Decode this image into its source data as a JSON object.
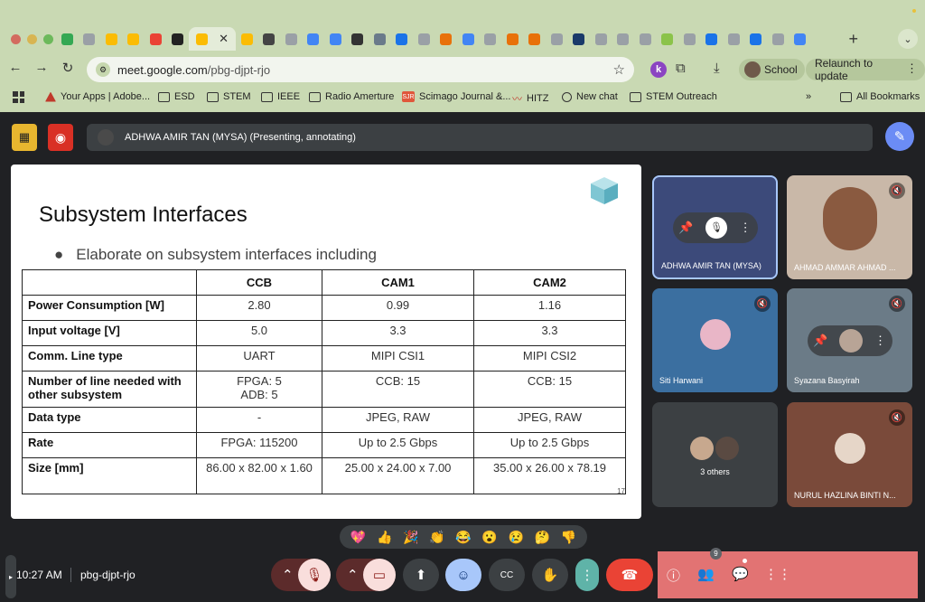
{
  "browser": {
    "tabs": [
      {
        "color": "#34a853"
      },
      {
        "color": "#9aa0a6"
      },
      {
        "color": "#fbbc04"
      },
      {
        "color": "#fbbc04"
      },
      {
        "color": "#ea4335"
      },
      {
        "color": "#222222"
      },
      {
        "color": "#fbbc04"
      },
      {
        "color": "#fbbc04"
      },
      {
        "color": "#444444"
      },
      {
        "color": "#9aa0a6"
      },
      {
        "color": "#4285f4"
      },
      {
        "color": "#4285f4"
      },
      {
        "color": "#333333"
      },
      {
        "color": "#6a7a8a"
      },
      {
        "color": "#1a73e8"
      },
      {
        "color": "#9aa0a6"
      },
      {
        "color": "#e8710a"
      },
      {
        "color": "#4285f4"
      },
      {
        "color": "#9aa0a6"
      },
      {
        "color": "#e8710a"
      },
      {
        "color": "#e8710a"
      },
      {
        "color": "#9aa0a6"
      },
      {
        "color": "#1a3a6a"
      },
      {
        "color": "#9aa0a6"
      },
      {
        "color": "#9aa0a6"
      },
      {
        "color": "#9aa0a6"
      },
      {
        "color": "#8bc34a"
      },
      {
        "color": "#9aa0a6"
      },
      {
        "color": "#1a73e8"
      },
      {
        "color": "#9aa0a6"
      },
      {
        "color": "#1a73e8"
      },
      {
        "color": "#9aa0a6"
      },
      {
        "color": "#4285f4"
      }
    ],
    "active_tab_close": "✕",
    "new_tab": "+",
    "url_host": "meet.google.com",
    "url_path": "/pbg-djpt-rjo",
    "profile_letter": "k",
    "school_label": "School",
    "relaunch_label": "Relaunch to update",
    "bookmarks": [
      {
        "label": "Your Apps | Adobe...",
        "icon": "adobe-icon"
      },
      {
        "label": "ESD",
        "icon": "folder-icon"
      },
      {
        "label": "STEM",
        "icon": "folder-icon"
      },
      {
        "label": "IEEE",
        "icon": "folder-icon"
      },
      {
        "label": "Radio Amerture",
        "icon": "folder-icon"
      },
      {
        "label": "Scimago Journal &...",
        "icon": "sjr-icon"
      },
      {
        "label": "HITZ",
        "icon": "hitz-icon"
      },
      {
        "label": "New chat",
        "icon": "openai-icon"
      },
      {
        "label": "STEM Outreach",
        "icon": "folder-icon"
      }
    ],
    "bookmarks_more": "»",
    "all_bookmarks": "All Bookmarks",
    "sjr_badge": "SJR",
    "hitz_badge": "〰"
  },
  "meet": {
    "presenter_text": "ADHWA AMIR TAN (MYSA) (Presenting, annotating)",
    "slide": {
      "title": "Subsystem Interfaces",
      "bullet": "Elaborate on subsystem interfaces including",
      "page_number": "17",
      "table": {
        "headers": [
          "",
          "CCB",
          "CAM1",
          "CAM2"
        ],
        "rows": [
          {
            "label": "Power Consumption [W]",
            "ccb": "2.80",
            "cam1": "0.99",
            "cam2": "1.16"
          },
          {
            "label": "Input voltage [V]",
            "ccb": "5.0",
            "cam1": "3.3",
            "cam2": "3.3"
          },
          {
            "label": "Comm. Line type",
            "ccb": "UART",
            "cam1": "MIPI CSI1",
            "cam2": "MIPI CSI2"
          },
          {
            "label": "Number of line needed with other subsystem",
            "ccb": "FPGA: 5\nADB: 5",
            "cam1": "CCB: 15",
            "cam2": "CCB: 15"
          },
          {
            "label": "Data type",
            "ccb": "-",
            "cam1": "JPEG, RAW",
            "cam2": "JPEG, RAW"
          },
          {
            "label": "Rate",
            "ccb": "FPGA: 115200",
            "cam1": "Up to 2.5 Gbps",
            "cam2": "Up to 2.5 Gbps"
          },
          {
            "label": "Size [mm]",
            "ccb": "86.00 x 82.00 x 1.60",
            "cam1": "25.00 x 24.00 x 7.00",
            "cam2": "35.00 x 26.00 x 78.19"
          }
        ]
      }
    },
    "participants": [
      {
        "name": "ADHWA AMIR TAN (MYSA)",
        "bg": "#3c4a7a"
      },
      {
        "name": "AHMAD AMMAR AHMAD ...",
        "bg": "#c9b8a8"
      },
      {
        "name": "Siti Harwani",
        "bg": "#3b6fa0"
      },
      {
        "name": "Syazana Basyirah",
        "bg": "#6b7b87"
      },
      {
        "name": "3 others",
        "bg": "#3c4043"
      },
      {
        "name": "NURUL HAZLINA BINTI N...",
        "bg": "#7a4a3a"
      }
    ],
    "reactions": [
      "💖",
      "👍",
      "🎉",
      "👏",
      "😂",
      "😮",
      "😢",
      "🤔",
      "👎"
    ],
    "clock": "10:27 AM",
    "meeting_code": "pbg-djpt-rjo",
    "people_count": "9"
  }
}
